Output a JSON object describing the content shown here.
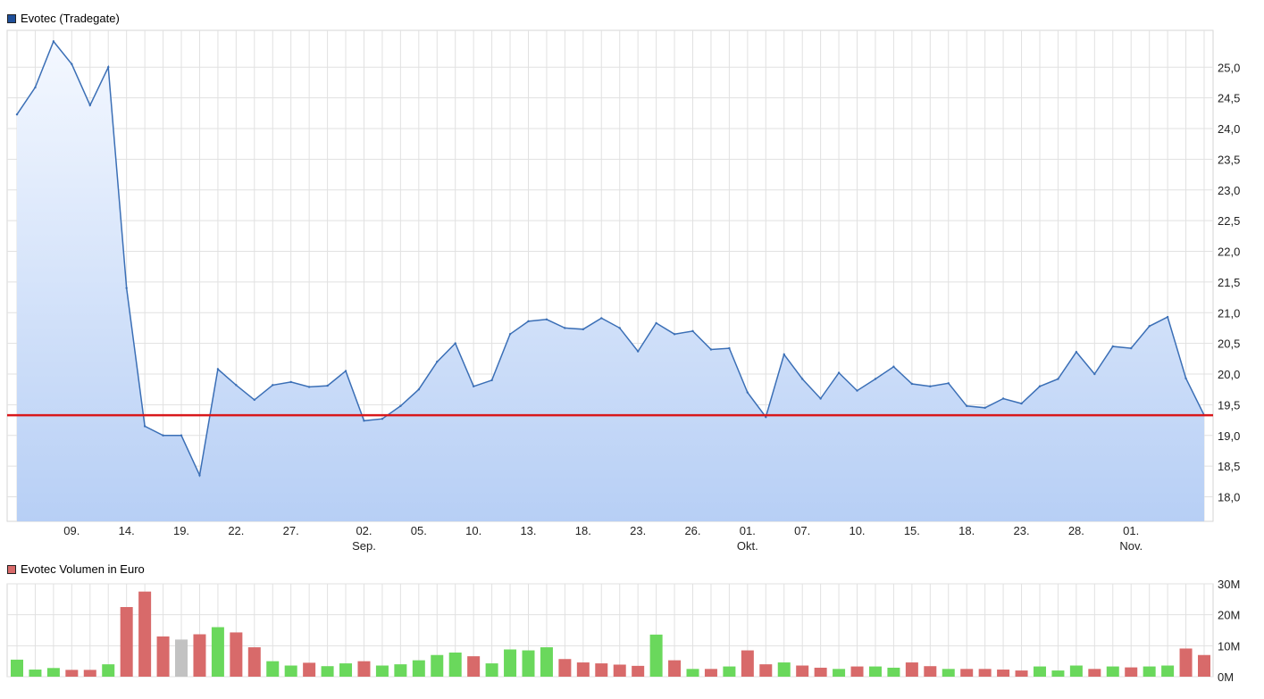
{
  "chart_data": [
    {
      "type": "area",
      "legend": "Evotec (Tradegate)",
      "colors": {
        "line": "#3b6fb6",
        "fill_top": "#f4f8ff",
        "fill_bottom": "#b7cff5",
        "reference": "#d9191c",
        "swatch": "#1f4f9a"
      },
      "ylim": [
        17.6,
        25.6
      ],
      "y_ticks": [
        "25,0",
        "24,5",
        "24,0",
        "23,5",
        "23,0",
        "22,5",
        "22,0",
        "21,5",
        "21,0",
        "20,5",
        "20,0",
        "19,5",
        "19,0",
        "18,5",
        "18,0"
      ],
      "y_tick_values": [
        25.0,
        24.5,
        24.0,
        23.5,
        23.0,
        22.5,
        22.0,
        21.5,
        21.0,
        20.5,
        20.0,
        19.5,
        19.0,
        18.5,
        18.0
      ],
      "x_tick_labels": [
        {
          "i": 3,
          "label": "09."
        },
        {
          "i": 6,
          "label": "14."
        },
        {
          "i": 9,
          "label": "19."
        },
        {
          "i": 12,
          "label": "22."
        },
        {
          "i": 15,
          "label": "27."
        },
        {
          "i": 19,
          "label": "02.",
          "sub": "Sep."
        },
        {
          "i": 22,
          "label": "05."
        },
        {
          "i": 25,
          "label": "10."
        },
        {
          "i": 28,
          "label": "13."
        },
        {
          "i": 31,
          "label": "18."
        },
        {
          "i": 34,
          "label": "23."
        },
        {
          "i": 37,
          "label": "26."
        },
        {
          "i": 40,
          "label": "01.",
          "sub": "Okt."
        },
        {
          "i": 43,
          "label": "07."
        },
        {
          "i": 46,
          "label": "10."
        },
        {
          "i": 49,
          "label": "15."
        },
        {
          "i": 52,
          "label": "18."
        },
        {
          "i": 55,
          "label": "23."
        },
        {
          "i": 58,
          "label": "28."
        },
        {
          "i": 61,
          "label": "01.",
          "sub": "Nov."
        }
      ],
      "reference_value": 19.33,
      "values": [
        24.23,
        24.67,
        25.42,
        25.05,
        24.38,
        25.0,
        21.4,
        19.15,
        19.0,
        19.0,
        18.35,
        20.08,
        19.82,
        19.58,
        19.82,
        19.87,
        19.79,
        19.81,
        20.05,
        19.24,
        19.27,
        19.48,
        19.75,
        20.2,
        20.5,
        19.8,
        19.9,
        20.65,
        20.86,
        20.89,
        20.75,
        20.73,
        20.91,
        20.75,
        20.37,
        20.83,
        20.65,
        20.7,
        20.4,
        20.42,
        19.7,
        19.3,
        20.32,
        19.92,
        19.6,
        20.02,
        19.73,
        19.92,
        20.12,
        19.84,
        19.8,
        19.85,
        19.48,
        19.45,
        19.6,
        19.52,
        19.8,
        19.92,
        20.36,
        20.0,
        20.45,
        20.42,
        20.78,
        20.93,
        19.93,
        19.33
      ]
    },
    {
      "type": "bar",
      "legend": "Evotec Volumen in Euro",
      "colors": {
        "up": "#6ad85c",
        "down": "#d86a6a",
        "neutral": "#c2c2c2",
        "swatch": "#d86a6a"
      },
      "ylim": [
        0,
        30
      ],
      "y_ticks": [
        "30M",
        "20M",
        "10M",
        "0M"
      ],
      "y_tick_values": [
        30,
        20,
        10,
        0
      ],
      "values": [
        5.5,
        2.3,
        2.8,
        2.2,
        2.2,
        4.0,
        22.5,
        27.5,
        13.0,
        12.0,
        13.7,
        16.0,
        14.3,
        9.5,
        5.0,
        3.6,
        4.5,
        3.4,
        4.3,
        5.0,
        3.6,
        4.0,
        5.3,
        7.0,
        7.8,
        6.6,
        4.3,
        8.8,
        8.5,
        9.5,
        5.7,
        4.6,
        4.3,
        3.9,
        3.5,
        13.6,
        5.3,
        2.5,
        2.5,
        3.3,
        8.5,
        4.0,
        4.6,
        3.6,
        2.9,
        2.5,
        3.3,
        3.3,
        2.9,
        4.6,
        3.4,
        2.5,
        2.5,
        2.5,
        2.3,
        2.0,
        3.3,
        2.0,
        3.6,
        2.5,
        3.3,
        3.0,
        3.3,
        3.6,
        9.1,
        7.0
      ],
      "directions": [
        "u",
        "u",
        "u",
        "d",
        "d",
        "u",
        "d",
        "d",
        "d",
        "n",
        "d",
        "u",
        "d",
        "d",
        "u",
        "u",
        "d",
        "u",
        "u",
        "d",
        "u",
        "u",
        "u",
        "u",
        "u",
        "d",
        "u",
        "u",
        "u",
        "u",
        "d",
        "d",
        "d",
        "d",
        "d",
        "u",
        "d",
        "u",
        "d",
        "u",
        "d",
        "d",
        "u",
        "d",
        "d",
        "u",
        "d",
        "u",
        "u",
        "d",
        "d",
        "u",
        "d",
        "d",
        "d",
        "d",
        "u",
        "u",
        "u",
        "d",
        "u",
        "d",
        "u",
        "u",
        "d",
        "d"
      ]
    }
  ]
}
